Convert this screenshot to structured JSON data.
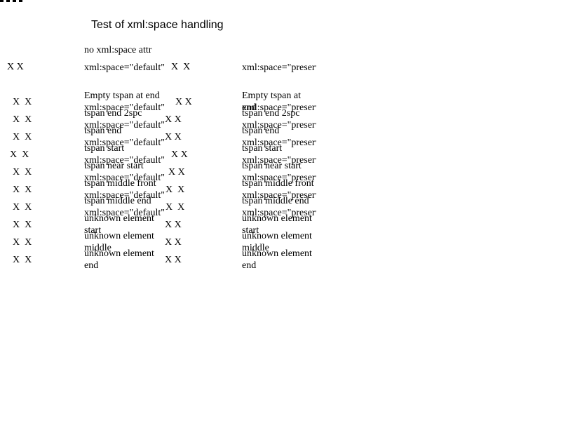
{
  "title": "Test of xml:space handling",
  "header_no_attr": "no xml:space attr",
  "row0": {
    "x_left": "X X",
    "default_label": "xml:space=\"default\"",
    "x_mid": "X  X",
    "preserve_label": "xml:space=\"preserve\""
  },
  "rows": [
    {
      "left": "X  X",
      "col1": "Empty tspan at end",
      "col1b": "xml:space=\"default\"",
      "mid": "X X",
      "col2": "Empty tspan at end",
      "col2b": "xml:space=\"preserve\""
    },
    {
      "left": "X  X",
      "col1": "tspan end 2spc",
      "col1b": "xml:space=\"default\"",
      "mid": "X X",
      "col2": "tspan end 2spc",
      "col2b": "xml:space=\"preserve\""
    },
    {
      "left": "X  X",
      "col1": "tspan end",
      "col1b": "xml:space=\"default\"",
      "mid": "X X",
      "col2": "tspan end",
      "col2b": "xml:space=\"preserve\""
    },
    {
      "left": "X  X",
      "col1": "tspan start",
      "col1b": "xml:space=\"default\"",
      "mid": "X X",
      "col2": "tspan start",
      "col2b": "xml:space=\"preserve\""
    },
    {
      "left": "X  X",
      "col1": "tspan near start",
      "col1b": "xml:space=\"default\"",
      "mid": "X X",
      "col2": "tspan near start",
      "col2b": "xml:space=\"preserve\""
    },
    {
      "left": "X  X",
      "col1": "tspan middle front",
      "col1b": "xml:space=\"default\"",
      "mid": "X  X",
      "col2": "tspan middle front",
      "col2b": "xml:space=\"preserve\""
    },
    {
      "left": "X  X",
      "col1": "tspan middle end",
      "col1b": "xml:space=\"default\"",
      "mid": "X  X",
      "col2": "tspan middle end",
      "col2b": "xml:space=\"preserve\""
    },
    {
      "left": "X  X",
      "col1": "unknown element start",
      "mid": "X X",
      "col2": "unknown element start"
    },
    {
      "left": "X  X",
      "col1": "unknown element middle",
      "mid": "X X",
      "col2": "unknown element middle"
    },
    {
      "left": "X  X",
      "col1": "unknown element end",
      "mid": "X X",
      "col2": "unknown element end"
    }
  ]
}
